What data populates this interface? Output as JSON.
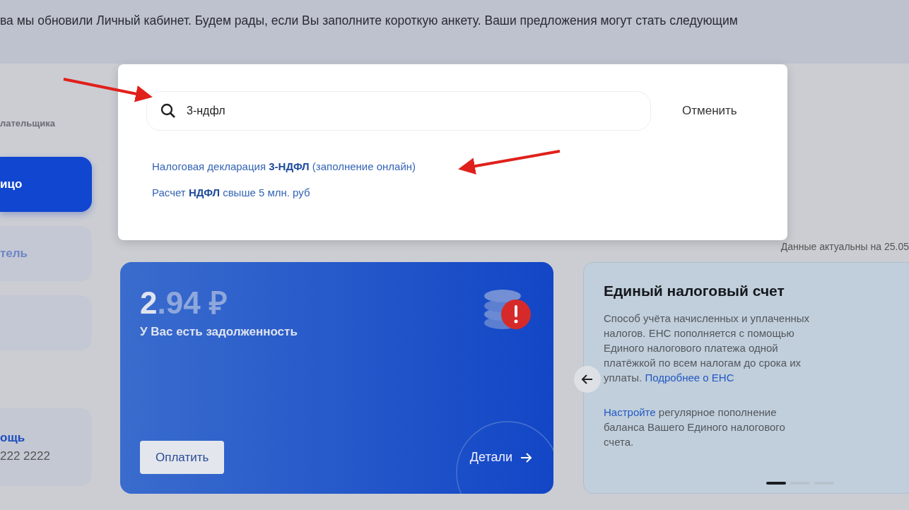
{
  "banner": {
    "text": "ва мы обновили Личный кабинет. Будем рады, если Вы заполните короткую анкету. Ваши предложения могут стать следующим"
  },
  "sidebar": {
    "caption": "лательщика",
    "items": [
      {
        "label": "ицо",
        "selected": true
      },
      {
        "label": "тель",
        "selected": false
      },
      {
        "selected": false
      }
    ],
    "help": {
      "title": "ощь",
      "phone": "222 2222"
    }
  },
  "search": {
    "value": "3-ндфл",
    "cancel": "Отменить",
    "results": [
      "Налоговая декларация **3-НДФЛ** (заполнение онлайн)",
      "Расчет **НДФЛ** свыше 5 млн. руб"
    ]
  },
  "data_date": "Данные актуальны на 25.05",
  "debt_card": {
    "amount_main": "2",
    "amount_rest": ".94 ₽",
    "caption": "У Вас есть задолженность",
    "pay_button": "Оплатить",
    "details_link": "Детали"
  },
  "ens_card": {
    "title": "Единый налоговый счет",
    "description": "Способ учёта начисленных и уплаченных налогов. ЕНС пополняется с помощью Единого налогового платежа одной платёжкой по всем налогам до срока их уплаты.",
    "description_link": "Подробнее о ЕНС",
    "setup_link": "Настройте",
    "setup_text": "регулярное пополнение баланса Вашего Единого налогового счета.",
    "dots": [
      {
        "selected": true
      },
      {
        "selected": false
      },
      {
        "selected": false
      }
    ]
  }
}
